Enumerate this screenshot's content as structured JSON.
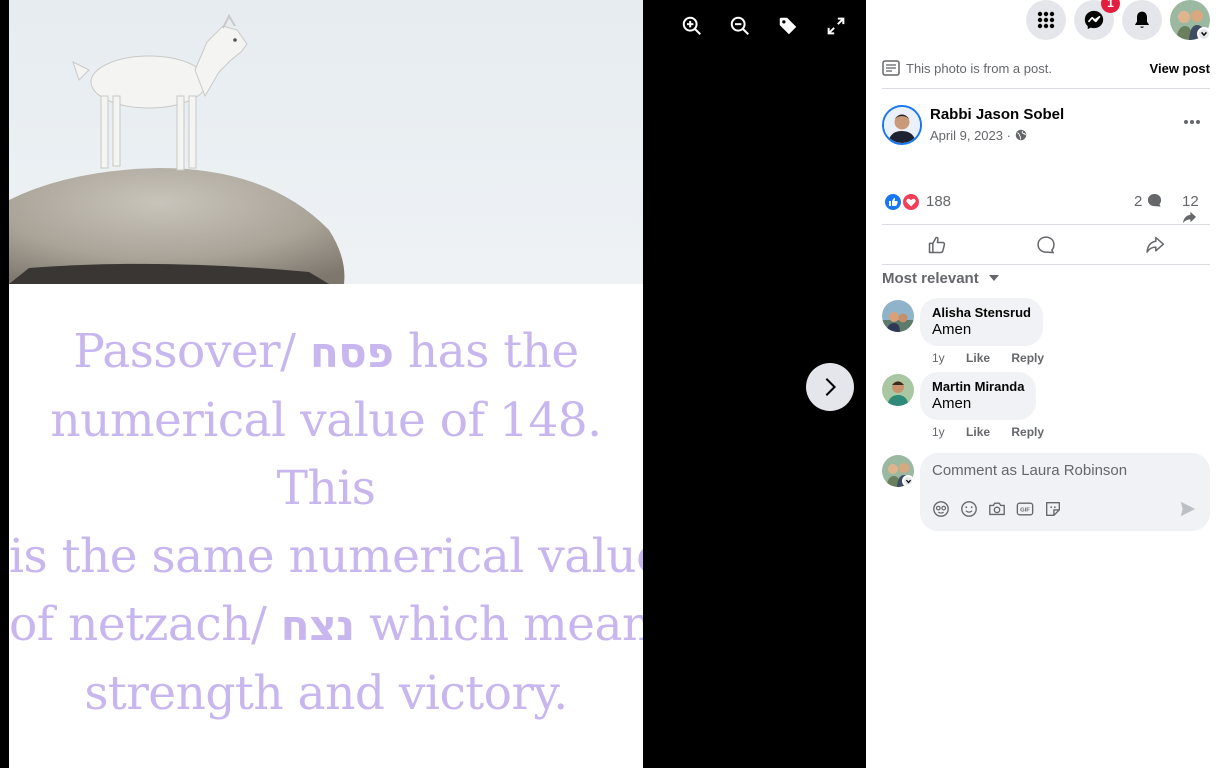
{
  "viewer": {
    "tools": [
      "zoom-in-icon",
      "zoom-out-icon",
      "tag-icon",
      "fullscreen-icon"
    ],
    "next_icon": "chevron-right-icon",
    "photo_caption_lines": [
      {
        "a": "Passover/ ",
        "heb": "פסח",
        "b": " has the"
      },
      {
        "a": "numerical value of 148."
      },
      {
        "a": "This"
      },
      {
        "a": "is the same numerical value"
      },
      {
        "a": "of netzach/ ",
        "heb": "נצח",
        "b": " which means"
      },
      {
        "a": "strength and victory."
      }
    ]
  },
  "topbar": {
    "menu_icon": "grid-menu-icon",
    "messenger_icon": "messenger-icon",
    "messenger_badge": "1",
    "notifications_icon": "bell-icon",
    "account_icon": "profile-avatar"
  },
  "post": {
    "from_post_text": "This photo is from a post.",
    "view_post_label": "View post",
    "author": "Rabbi Jason Sobel",
    "date": "April 9, 2023 · ",
    "reaction_count": "188",
    "comment_count": "2",
    "share_count": "12"
  },
  "comments": {
    "sort_label": "Most relevant",
    "items": [
      {
        "author": "Alisha Stensrud",
        "text": "Amen",
        "age": "1y",
        "like": "Like",
        "reply": "Reply"
      },
      {
        "author": "Martin Miranda",
        "text": "Amen",
        "age": "1y",
        "like": "Like",
        "reply": "Reply"
      }
    ],
    "composer_placeholder": "Comment as Laura Robinson"
  },
  "colors": {
    "accent": "#1877f2",
    "caption": "#c8b6ee",
    "badge": "#e41e3f"
  }
}
